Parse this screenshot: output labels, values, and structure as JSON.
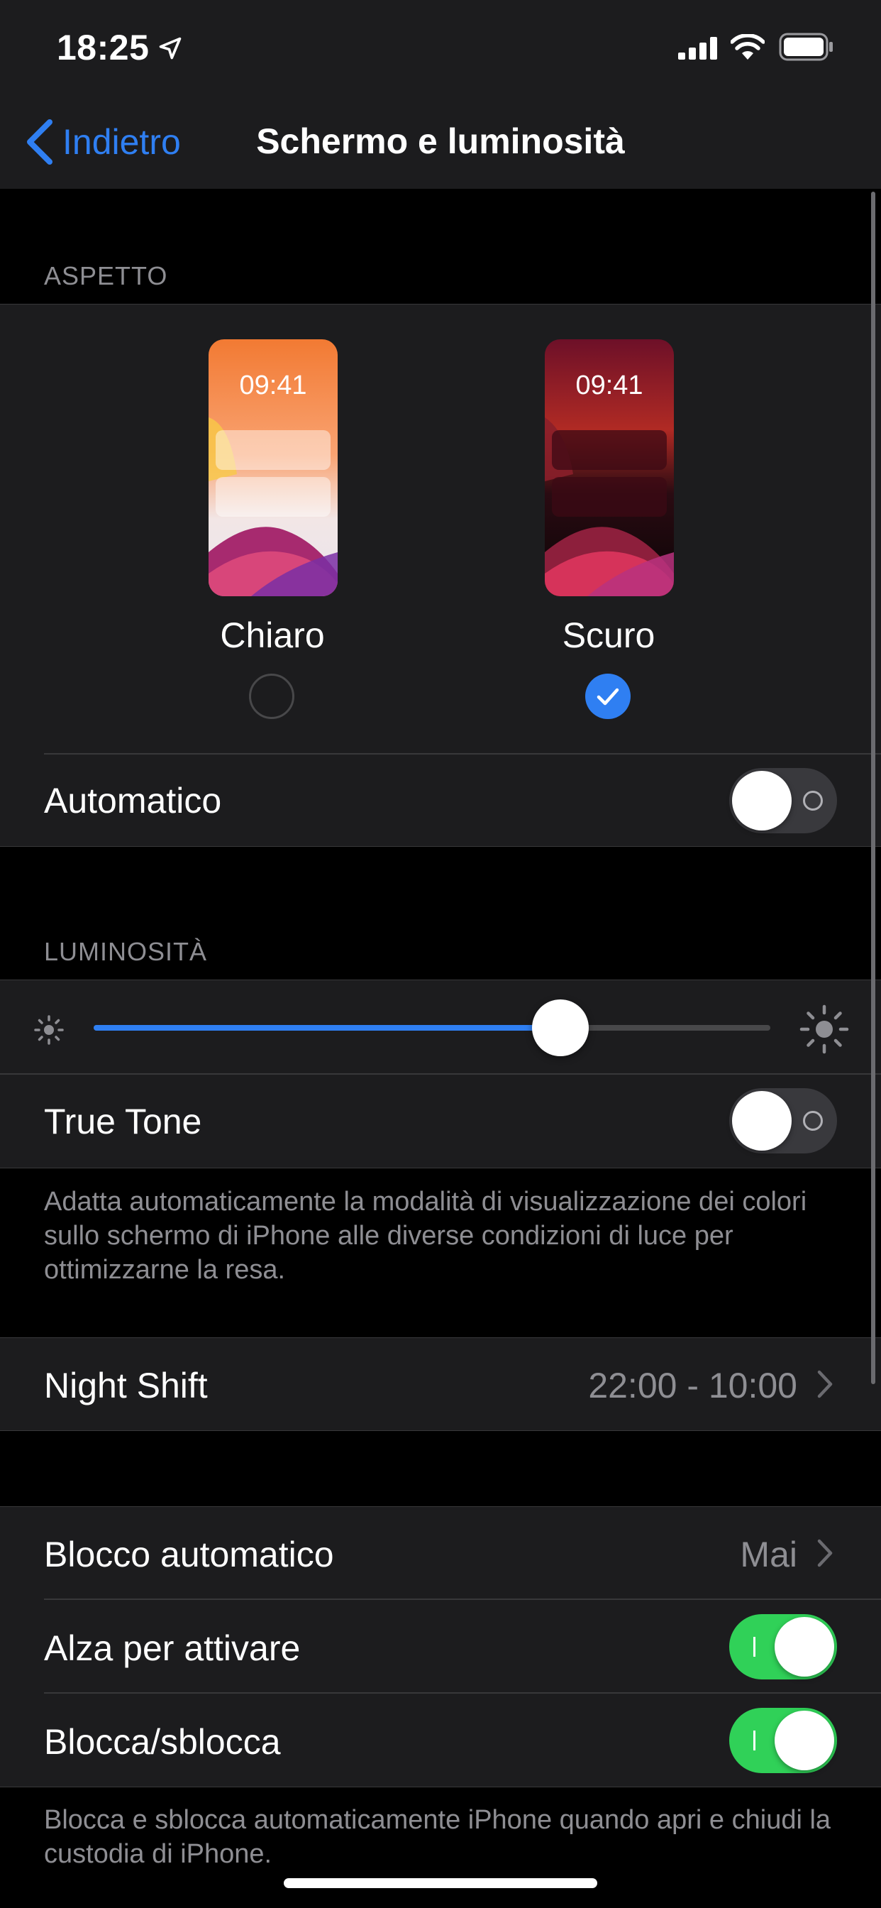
{
  "status_bar": {
    "time": "18:25",
    "icons": [
      "location-arrow-icon",
      "signal-icon",
      "wifi-icon",
      "battery-icon"
    ]
  },
  "nav": {
    "back_label": "Indietro",
    "title": "Schermo e luminosità"
  },
  "appearance": {
    "header": "ASPETTO",
    "options": [
      {
        "label": "Chiaro",
        "preview_time": "09:41",
        "selected": false
      },
      {
        "label": "Scuro",
        "preview_time": "09:41",
        "selected": true
      }
    ],
    "automatic_label": "Automatico",
    "automatic_on": false
  },
  "brightness": {
    "header": "LUMINOSITÀ",
    "level": 0.69,
    "true_tone_label": "True Tone",
    "true_tone_on": false,
    "footer": "Adatta automaticamente la modalità di visualizzazione dei colori sullo schermo di iPhone alle diverse condizioni di luce per ottimizzarne la resa."
  },
  "night_shift": {
    "label": "Night Shift",
    "value": "22:00 - 10:00"
  },
  "lock": {
    "auto_lock_label": "Blocco automatico",
    "auto_lock_value": "Mai",
    "raise_to_wake_label": "Alza per attivare",
    "raise_to_wake_on": true,
    "lock_unlock_label": "Blocca/sblocca",
    "lock_unlock_on": true,
    "footer": "Blocca e sblocca automaticamente iPhone quando apri e chiudi la custodia di iPhone."
  },
  "colors": {
    "accent": "#2f7ff2",
    "toggle_on": "#30d158",
    "background": "#000000",
    "cell": "#1c1c1e",
    "secondary_text": "#8e8e93"
  }
}
